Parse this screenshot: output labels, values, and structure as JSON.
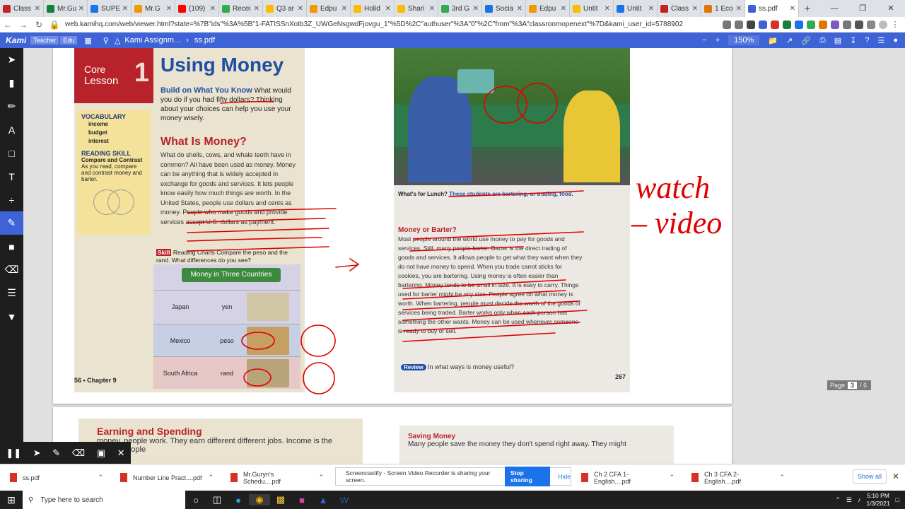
{
  "browser": {
    "tabs": [
      {
        "label": "Class",
        "color": "#c5221f"
      },
      {
        "label": "Mr.Gu",
        "color": "#188038"
      },
      {
        "label": "SUPE",
        "color": "#1a73e8"
      },
      {
        "label": "Mr.G",
        "color": "#f29900"
      },
      {
        "label": "(109)",
        "color": "#ff0000"
      },
      {
        "label": "Recei",
        "color": "#34a853"
      },
      {
        "label": "Q3 ar",
        "color": "#fbbc04"
      },
      {
        "label": "Edpu",
        "color": "#f29900"
      },
      {
        "label": "Holid",
        "color": "#fbbc04"
      },
      {
        "label": "Shari",
        "color": "#fbbc04"
      },
      {
        "label": "3rd G",
        "color": "#34a853"
      },
      {
        "label": "Socia",
        "color": "#1a73e8"
      },
      {
        "label": "Edpu",
        "color": "#f29900"
      },
      {
        "label": "Untit",
        "color": "#fbbc04"
      },
      {
        "label": "Untit",
        "color": "#1a73e8"
      },
      {
        "label": "Class",
        "color": "#c5221f"
      },
      {
        "label": "1 Eco",
        "color": "#e37400"
      }
    ],
    "active_tab": {
      "label": "ss.pdf",
      "color": "#3d63d6"
    },
    "url": "web.kamihq.com/web/viewer.html?state=%7B\"ids\"%3A%5B\"1-FATISSnXotb3Z_UWGeNsgwdFjovgu_1\"%5D%2C\"authuser\"%3A\"0\"%2C\"from\"%3A\"classroomopenext\"%7D&kami_user_id=5788902"
  },
  "kami": {
    "logo": "Kami",
    "badge1": "Teacher",
    "badge2": "Edu",
    "breadcrumb1": "Kami Assignm...",
    "breadcrumb2": "ss.pdf",
    "zoom": "150%",
    "size_value": "1"
  },
  "left_page": {
    "core": "Core",
    "lesson": "Lesson",
    "lesson_num": "1",
    "title": "Using Money",
    "build_head": "Build on What You Know",
    "build_text": "What would you do if you had fifty dollars? Thinking about your choices can help you use your money wisely.",
    "vocab_head": "VOCABULARY",
    "vocab": [
      "income",
      "budget",
      "interest"
    ],
    "reading_skill": "READING SKILL",
    "reading_skill_name": "Compare and Contrast",
    "reading_skill_text": "As you read, compare and contrast money and barter.",
    "section_head": "What Is Money?",
    "section_text": "What do shells, cows, and whale teeth have in common? All have been used as money. Money can be anything that is widely accepted in exchange for goods and services. It lets people know easily how much things are worth. In the United States, people use dollars and cents as money. People who make goods and provide services accept U.S. dollars as payment.",
    "skill_tag": "Skill",
    "skill_text": "Reading Charts  Compare the peso and the rand. What differences do you see?",
    "table_title": "Money in Three Countries",
    "table_rows": [
      {
        "country": "Japan",
        "currency": "yen"
      },
      {
        "country": "Mexico",
        "currency": "peso"
      },
      {
        "country": "South Africa",
        "currency": "rand"
      }
    ],
    "footer": "56 • Chapter 9"
  },
  "right_page": {
    "caption_lead": "What's for Lunch?",
    "caption_text": "These students are bartering, or trading, food.",
    "section_head": "Money or Barter?",
    "section_text": "Most people around the world use money to pay for goods and services. Still, many people barter. Barter is the direct trading of goods and services. It allows people to get what they want when they do not have money to spend. When you trade carrot sticks for cookies, you are bartering. Using money is often easier than bartering. Money tends to be small in size. It is easy to carry. Things used for barter might be any size. People agree on what money is worth. When bartering, people must decide the worth of the goods or services being traded. Barter works only when each person has something the other wants. Money can be used whenever someone is ready to buy or sell.",
    "review_tag": "Review",
    "review_text": "In what ways is money useful?",
    "page_num": "267"
  },
  "annotations": {
    "handwriting1": "watch",
    "handwriting2": "– video",
    "ink_color": "#e00000"
  },
  "page2": {
    "left_head": "Earning and Spending",
    "left_text": "money, people work. They earn different different jobs. Income is the money people",
    "right_head": "Saving Money",
    "right_text": "Many people save the money they don't spend right away. They might"
  },
  "page_indicator": {
    "label": "Page",
    "current": "3",
    "total": "/ 6"
  },
  "downloads": [
    {
      "name": "ss.pdf"
    },
    {
      "name": "Number Line Pract....pdf"
    },
    {
      "name": "Mr.Guryn's Schedu....pdf"
    },
    {
      "name": "Ch 2 CFA 1-English....pdf"
    },
    {
      "name": "Ch 3 CFA 2-English....pdf"
    }
  ],
  "screencastify": {
    "text": "Screencastify - Screen Video Recorder is sharing your screen.",
    "stop": "Stop sharing",
    "hide": "Hide"
  },
  "show_all": "Show all",
  "taskbar": {
    "search_placeholder": "Type here to search",
    "time": "5:10 PM",
    "date": "1/3/2021"
  }
}
